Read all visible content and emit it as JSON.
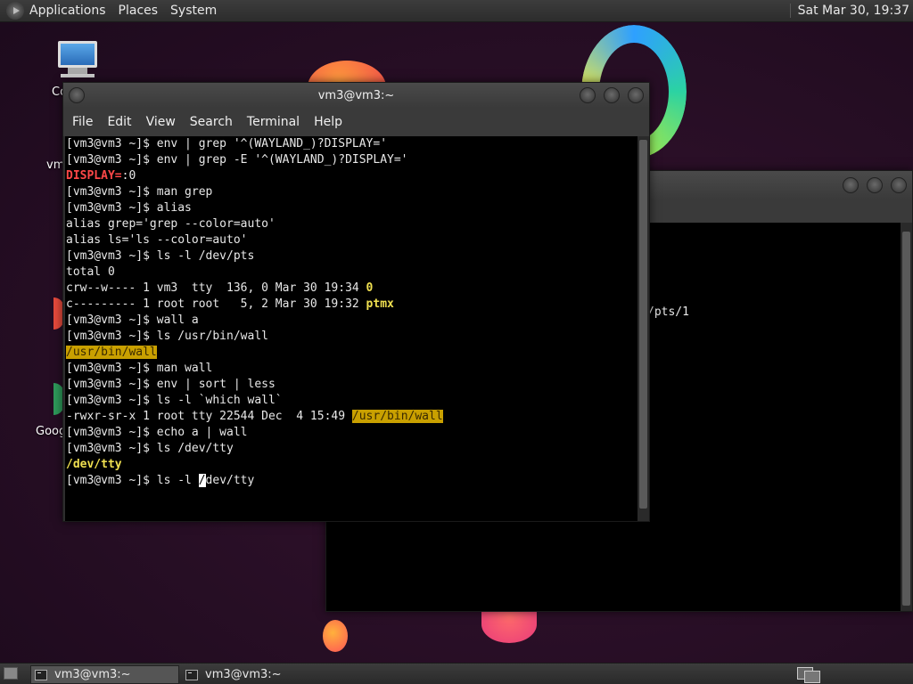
{
  "top_panel": {
    "menus": [
      "Applications",
      "Places",
      "System"
    ],
    "clock": "Sat Mar 30, 19:37"
  },
  "desktop": {
    "icons": [
      {
        "label_fragment": "Co"
      },
      {
        "label_fragment": "vm"
      },
      {
        "label_fragment": "Goog"
      }
    ]
  },
  "back_window": {
    "terminal_fragment": "/pts/1"
  },
  "main_window": {
    "title": "vm3@vm3:~",
    "menu": [
      "File",
      "Edit",
      "View",
      "Search",
      "Terminal",
      "Help"
    ],
    "lines": [
      [
        {
          "t": "[vm3@vm3 ~]$ env | grep '^(WAYLAND_)?DISPLAY='"
        }
      ],
      [
        {
          "t": "[vm3@vm3 ~]$ env | grep -E '^(WAYLAND_)?DISPLAY='"
        }
      ],
      [
        {
          "t": "DISPLAY=",
          "c": "red"
        },
        {
          "t": ":0"
        }
      ],
      [
        {
          "t": "[vm3@vm3 ~]$ man grep"
        }
      ],
      [
        {
          "t": "[vm3@vm3 ~]$ alias"
        }
      ],
      [
        {
          "t": "alias grep='grep --color=auto'"
        }
      ],
      [
        {
          "t": "alias ls='ls --color=auto'"
        }
      ],
      [
        {
          "t": "[vm3@vm3 ~]$ ls -l /dev/pts"
        }
      ],
      [
        {
          "t": "total 0"
        }
      ],
      [
        {
          "t": "crw--w---- 1 vm3  tty  136, 0 Mar 30 19:34 "
        },
        {
          "t": "0",
          "c": "yellow"
        }
      ],
      [
        {
          "t": "c--------- 1 root root   5, 2 Mar 30 19:32 "
        },
        {
          "t": "ptmx",
          "c": "yellow"
        }
      ],
      [
        {
          "t": "[vm3@vm3 ~]$ wall a"
        }
      ],
      [
        {
          "t": "[vm3@vm3 ~]$ ls /usr/bin/wall"
        }
      ],
      [
        {
          "t": "/usr/bin/wall",
          "c": "hl"
        }
      ],
      [
        {
          "t": "[vm3@vm3 ~]$ man wall"
        }
      ],
      [
        {
          "t": "[vm3@vm3 ~]$ env | sort | less"
        }
      ],
      [
        {
          "t": "[vm3@vm3 ~]$ ls -l `which wall`"
        }
      ],
      [
        {
          "t": "-rwxr-sr-x 1 root tty 22544 Dec  4 15:49 "
        },
        {
          "t": "/usr/bin/wall",
          "c": "hl"
        }
      ],
      [
        {
          "t": "[vm3@vm3 ~]$ echo a | wall"
        }
      ],
      [
        {
          "t": "[vm3@vm3 ~]$ ls /dev/tty"
        }
      ],
      [
        {
          "t": "/dev/tty",
          "c": "yellow"
        }
      ],
      [
        {
          "t": "[vm3@vm3 ~]$ ls -l "
        },
        {
          "t": "/",
          "c": "cursor"
        },
        {
          "t": "dev/tty"
        }
      ]
    ]
  },
  "bottom_panel": {
    "tasks": [
      "vm3@vm3:~",
      "vm3@vm3:~"
    ]
  }
}
